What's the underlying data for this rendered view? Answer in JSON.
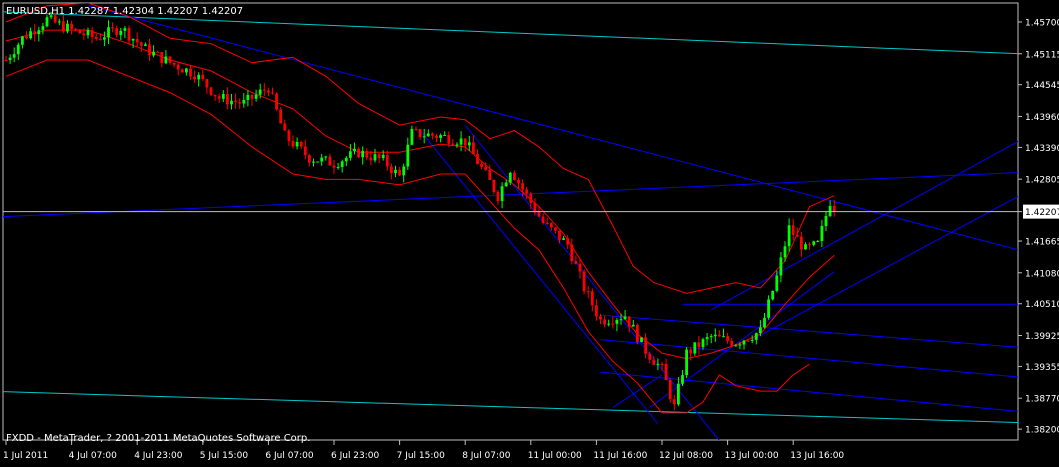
{
  "chart_window": {
    "symbol_line": "EURUSD,H1  1.42287 1.42304 1.42207 1.42207",
    "copyright": "FXDD - MetaTrader, ? 2001-2011 MetaQuotes Software Corp."
  },
  "colors": {
    "background": "#000000",
    "frame": "#c0c0c0",
    "text": "#ffffff",
    "bull_candle": "#00ff00",
    "bear_candle": "#ff0000",
    "bollinger": "#ff0000",
    "trendline": "#0000ff",
    "level_line": "#00c8c8",
    "current_price_line": "#c0c0c0",
    "price_label_bg": "#ffffff",
    "price_label_text": "#000000"
  },
  "chart_data": {
    "type": "candlestick",
    "symbol": "EURUSD",
    "timeframe": "H1",
    "last_price": "1.42207",
    "ylim": [
      1.38,
      1.4605
    ],
    "y_ticks": [
      "1.45700",
      "1.45115",
      "1.44545",
      "1.43960",
      "1.43390",
      "1.42805",
      "1.42207",
      "1.41665",
      "1.41080",
      "1.40510",
      "1.39925",
      "1.39355",
      "1.38770",
      "1.38200"
    ],
    "x_tick_labels": [
      "1 Jul 2011",
      "4 Jul 07:00",
      "4 Jul 23:00",
      "5 Jul 15:00",
      "6 Jul 07:00",
      "6 Jul 23:00",
      "7 Jul 15:00",
      "8 Jul 07:00",
      "11 Jul 00:00",
      "11 Jul 16:00",
      "12 Jul 08:00",
      "13 Jul 00:00",
      "13 Jul 16:00"
    ],
    "x_tick_bar_index": [
      0,
      16,
      32,
      48,
      64,
      80,
      96,
      112,
      128,
      144,
      160,
      176,
      192
    ],
    "bar_count": 203,
    "price_path_anchors": [
      [
        0,
        1.45
      ],
      [
        4,
        1.454
      ],
      [
        10,
        1.4575
      ],
      [
        16,
        1.4555
      ],
      [
        22,
        1.454
      ],
      [
        28,
        1.456
      ],
      [
        34,
        1.452
      ],
      [
        40,
        1.4495
      ],
      [
        46,
        1.4475
      ],
      [
        52,
        1.443
      ],
      [
        58,
        1.442
      ],
      [
        64,
        1.445
      ],
      [
        68,
        1.436
      ],
      [
        74,
        1.432
      ],
      [
        80,
        1.431
      ],
      [
        86,
        1.433
      ],
      [
        92,
        1.4315
      ],
      [
        96,
        1.4285
      ],
      [
        99,
        1.4365
      ],
      [
        106,
        1.436
      ],
      [
        112,
        1.435
      ],
      [
        116,
        1.43
      ],
      [
        120,
        1.425
      ],
      [
        123,
        1.43
      ],
      [
        127,
        1.425
      ],
      [
        131,
        1.42
      ],
      [
        137,
        1.416
      ],
      [
        141,
        1.408
      ],
      [
        145,
        1.402
      ],
      [
        151,
        1.403
      ],
      [
        156,
        1.3965
      ],
      [
        160,
        1.393
      ],
      [
        163,
        1.386
      ],
      [
        166,
        1.396
      ],
      [
        172,
        1.399
      ],
      [
        178,
        1.398
      ],
      [
        184,
        1.4
      ],
      [
        188,
        1.41
      ],
      [
        191,
        1.419
      ],
      [
        195,
        1.415
      ],
      [
        198,
        1.416
      ],
      [
        201,
        1.424
      ],
      [
        202,
        1.4221
      ]
    ],
    "bollinger": {
      "upper": [
        [
          0,
          1.457
        ],
        [
          10,
          1.46
        ],
        [
          20,
          1.4605
        ],
        [
          30,
          1.458
        ],
        [
          40,
          1.454
        ],
        [
          50,
          1.453
        ],
        [
          60,
          1.4495
        ],
        [
          70,
          1.4505
        ],
        [
          78,
          1.447
        ],
        [
          86,
          1.442
        ],
        [
          96,
          1.438
        ],
        [
          106,
          1.4395
        ],
        [
          112,
          1.439
        ],
        [
          118,
          1.4355
        ],
        [
          124,
          1.437
        ],
        [
          130,
          1.434
        ],
        [
          136,
          1.43
        ],
        [
          142,
          1.428
        ],
        [
          148,
          1.4195
        ],
        [
          153,
          1.412
        ],
        [
          158,
          1.409
        ],
        [
          166,
          1.407
        ],
        [
          172,
          1.408
        ],
        [
          178,
          1.409
        ],
        [
          184,
          1.408
        ],
        [
          190,
          1.413
        ],
        [
          196,
          1.423
        ],
        [
          202,
          1.425
        ]
      ],
      "middle": [
        [
          0,
          1.4535
        ],
        [
          10,
          1.4555
        ],
        [
          20,
          1.4555
        ],
        [
          30,
          1.453
        ],
        [
          40,
          1.45
        ],
        [
          50,
          1.448
        ],
        [
          60,
          1.444
        ],
        [
          70,
          1.441
        ],
        [
          78,
          1.436
        ],
        [
          86,
          1.433
        ],
        [
          96,
          1.433
        ],
        [
          106,
          1.4345
        ],
        [
          112,
          1.434
        ],
        [
          118,
          1.43
        ],
        [
          124,
          1.427
        ],
        [
          130,
          1.423
        ],
        [
          136,
          1.418
        ],
        [
          142,
          1.411
        ],
        [
          148,
          1.405
        ],
        [
          154,
          1.3995
        ],
        [
          160,
          1.396
        ],
        [
          166,
          1.395
        ],
        [
          172,
          1.396
        ],
        [
          178,
          1.3975
        ],
        [
          184,
          1.3995
        ],
        [
          190,
          1.405
        ],
        [
          196,
          1.41
        ],
        [
          202,
          1.414
        ]
      ],
      "lower": [
        [
          0,
          1.447
        ],
        [
          10,
          1.45
        ],
        [
          20,
          1.45
        ],
        [
          30,
          1.447
        ],
        [
          40,
          1.444
        ],
        [
          50,
          1.44
        ],
        [
          60,
          1.434
        ],
        [
          70,
          1.429
        ],
        [
          78,
          1.428
        ],
        [
          86,
          1.428
        ],
        [
          96,
          1.427
        ],
        [
          106,
          1.429
        ],
        [
          112,
          1.429
        ],
        [
          118,
          1.424
        ],
        [
          124,
          1.419
        ],
        [
          130,
          1.415
        ],
        [
          136,
          1.408
        ],
        [
          142,
          1.4
        ],
        [
          148,
          1.3945
        ],
        [
          154,
          1.3905
        ],
        [
          160,
          1.385
        ],
        [
          166,
          1.385
        ],
        [
          170,
          1.387
        ],
        [
          174,
          1.392
        ],
        [
          178,
          1.39
        ],
        [
          184,
          1.389
        ],
        [
          188,
          1.389
        ],
        [
          192,
          1.392
        ],
        [
          196,
          1.394
        ]
      ]
    },
    "trendlines": [
      {
        "name": "upper-descending",
        "color": "#0000ff",
        "p1": [
          20,
          1.46
        ],
        "p2": [
          300,
          1.4045
        ]
      },
      {
        "name": "lower-ascending",
        "color": "#0000ff",
        "p1": [
          -5,
          1.421
        ],
        "p2": [
          300,
          1.431
        ]
      },
      {
        "name": "channel-ascending-top",
        "color": "#0000ff",
        "p1": [
          172,
          1.404
        ],
        "p2": [
          300,
          1.457
        ]
      },
      {
        "name": "channel-ascending-mid",
        "color": "#0000ff",
        "p1": [
          182,
          1.3985
        ],
        "p2": [
          300,
          1.4465
        ]
      },
      {
        "name": "channel-ascending-bottom",
        "color": "#0000ff",
        "p1": [
          157,
          1.386
        ],
        "p2": [
          202,
          1.411
        ]
      },
      {
        "name": "descending-channel-top",
        "color": "#0000ff",
        "p1": [
          112,
          1.438
        ],
        "p2": [
          176,
          1.378
        ]
      },
      {
        "name": "descending-channel-bottom",
        "color": "#0000ff",
        "p1": [
          101,
          1.437
        ],
        "p2": [
          159,
          1.383
        ]
      },
      {
        "name": "fan-line-1",
        "color": "#0000ff",
        "p1": [
          145,
          1.403
        ],
        "p2": [
          300,
          1.394
        ]
      },
      {
        "name": "fan-line-2",
        "color": "#0000ff",
        "p1": [
          145,
          1.3985
        ],
        "p2": [
          300,
          1.388
        ]
      },
      {
        "name": "fan-line-3",
        "color": "#0000ff",
        "p1": [
          145,
          1.3925
        ],
        "p2": [
          300,
          1.3815
        ]
      },
      {
        "name": "horizontal-support",
        "color": "#0000ff",
        "p1": [
          165,
          1.405
        ],
        "p2": [
          300,
          1.405
        ]
      },
      {
        "name": "dip-channel-left",
        "color": "#0000ff",
        "p1": [
          148,
          1.386
        ],
        "p2": [
          160,
          1.392
        ]
      }
    ],
    "level_lines": [
      {
        "name": "upper-cyan",
        "color": "#00c8c8",
        "p1": [
          -5,
          1.459
        ],
        "p2": [
          300,
          1.4495
        ]
      },
      {
        "name": "lower-cyan",
        "color": "#00c8c8",
        "p1": [
          -5,
          1.389
        ],
        "p2": [
          300,
          1.382
        ]
      }
    ]
  }
}
